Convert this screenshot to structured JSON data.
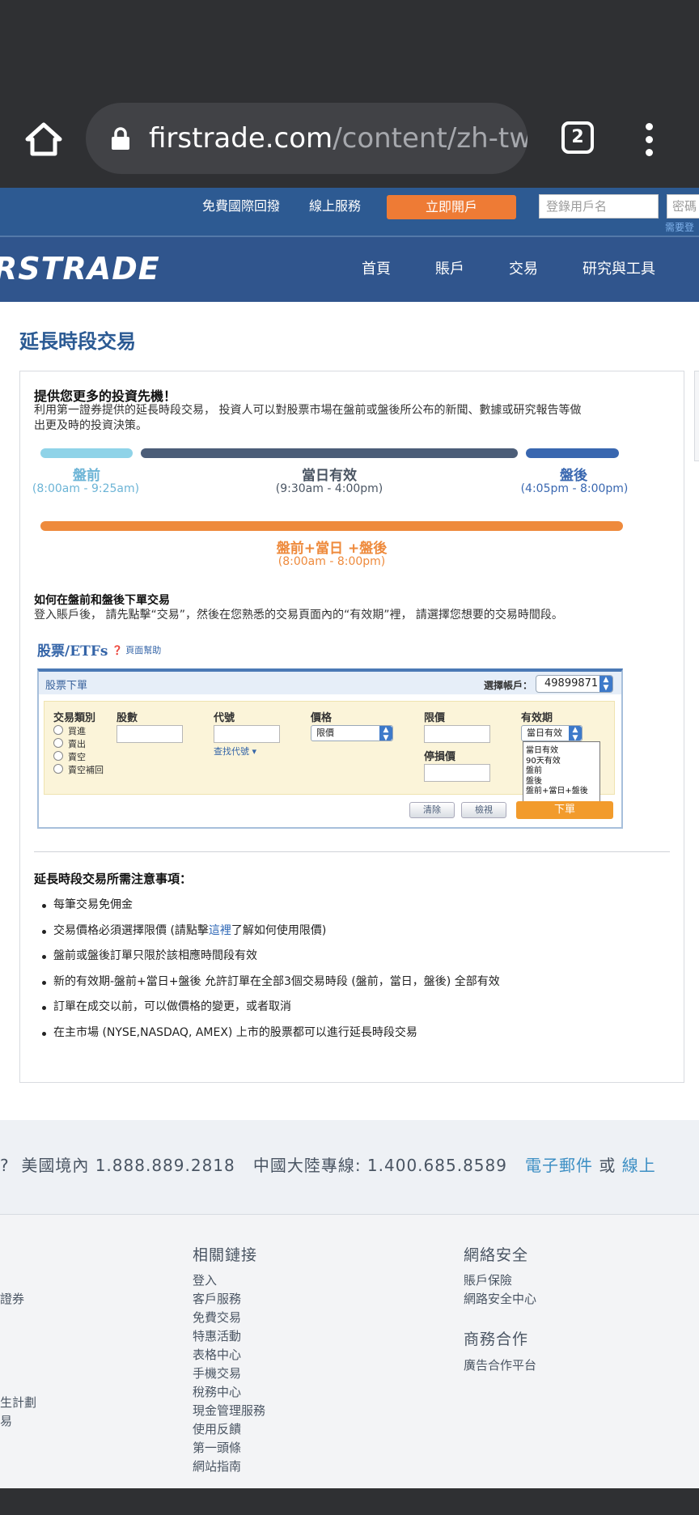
{
  "browser": {
    "url_host": "firstrade.com",
    "url_path": "/content/zh-tw/",
    "tab_count": "2",
    "icons": [
      "home-icon",
      "lock-icon",
      "tabs-icon",
      "more-vert-icon"
    ]
  },
  "site_header": {
    "top_links": [
      "免費國際回撥",
      "線上服務"
    ],
    "open_account": "立即開戶",
    "username_placeholder": "登錄用戶名",
    "password_placeholder": "密碼",
    "need_register": "需要登",
    "logo": "RSTRADE",
    "nav": [
      "首頁",
      "賬戶",
      "交易",
      "研究與工具"
    ]
  },
  "page": {
    "title": "延長時段交易",
    "intro_heading": "提供您更多的投資先機！",
    "intro_line1": "利用第一證券提供的延長時段交易， 投資人可以對股票市場在盤前或盤後所公布的新聞、數據或研究報告等做",
    "intro_line2": "出更及時的投資決策。",
    "sessions": [
      {
        "label": "盤前",
        "time": "(8:00am - 9:25am)",
        "color": "#8fd3e8"
      },
      {
        "label": "當日有效",
        "time": "(9:30am - 4:00pm)",
        "color": "#4b5d78"
      },
      {
        "label": "盤後",
        "time": "(4:05pm - 8:00pm)",
        "color": "#3967b0"
      }
    ],
    "combined_session": {
      "label": "盤前+當日 +盤後",
      "time": "(8:00am - 8:00pm)",
      "color": "#ee8a3c"
    },
    "howto_heading": "如何在盤前和盤後下單交易",
    "howto_text": "登入賬戶後， 請先點擊“交易”，然後在您熟悉的交易頁面內的“有效期”裡， 請選擇您想要的交易時間段。",
    "order_demo": {
      "section_title": "股票/ETFs",
      "help_link": "頁面幫助",
      "ticket_title": "股票下單",
      "account_label": "選擇帳戶：",
      "account_value": "49899871",
      "col_labels": {
        "type": "交易類別",
        "shares": "股數",
        "symbol": "代號",
        "price": "價格",
        "limit": "限價",
        "stop": "停損價",
        "validity": "有效期"
      },
      "types": [
        "買進",
        "賣出",
        "賣空",
        "賣空補回"
      ],
      "symbol_lookup": "查找代號 ▾",
      "price_value": "限價",
      "validity_value": "當日有效",
      "validity_options": [
        "當日有效",
        "90天有效",
        "盤前",
        "盤後",
        "盤前+當日+盤後"
      ],
      "btn_clear": "清除",
      "btn_review": "檢視",
      "btn_submit": "下單"
    },
    "notes_heading": "延長時段交易所需注意事項：",
    "notes": [
      "每筆交易免佣金",
      "盤前或盤後訂單只限於該相應時間段有效",
      "新的有效期-盤前+當日+盤後 允許訂單在全部3個交易時段 (盤前，當日，盤後) 全部有效",
      "訂單在成交以前，可以做價格的變更，或者取消",
      "在主市場 (NYSE,NASDAQ, AMEX) 上市的股票都可以進行延長時段交易"
    ],
    "note_limit": {
      "before": "交易價格必須選擇限價 (請點擊",
      "link": "這裡",
      "after": "了解如何使用限價)"
    }
  },
  "contact": {
    "lead": "?",
    "us": "美國境內 1.888.889.2818",
    "cn": "中國大陸專線: 1.400.685.8589",
    "email": "電子郵件",
    "or": "或",
    "online": "線上"
  },
  "footer": {
    "left_fragments": [
      "證券",
      "生計劃",
      "易"
    ],
    "related_heading": "相關鏈接",
    "related_links": [
      "登入",
      "客戶服務",
      "免費交易",
      "特惠活動",
      "表格中心",
      "手機交易",
      "稅務中心",
      "現金管理服務",
      "使用反饋",
      "第一頭條",
      "網站指南"
    ],
    "security_heading": "網絡安全",
    "security_links": [
      "賬戶保險",
      "網路安全中心"
    ],
    "biz_heading": "商務合作",
    "biz_links": [
      "廣告合作平台"
    ]
  }
}
